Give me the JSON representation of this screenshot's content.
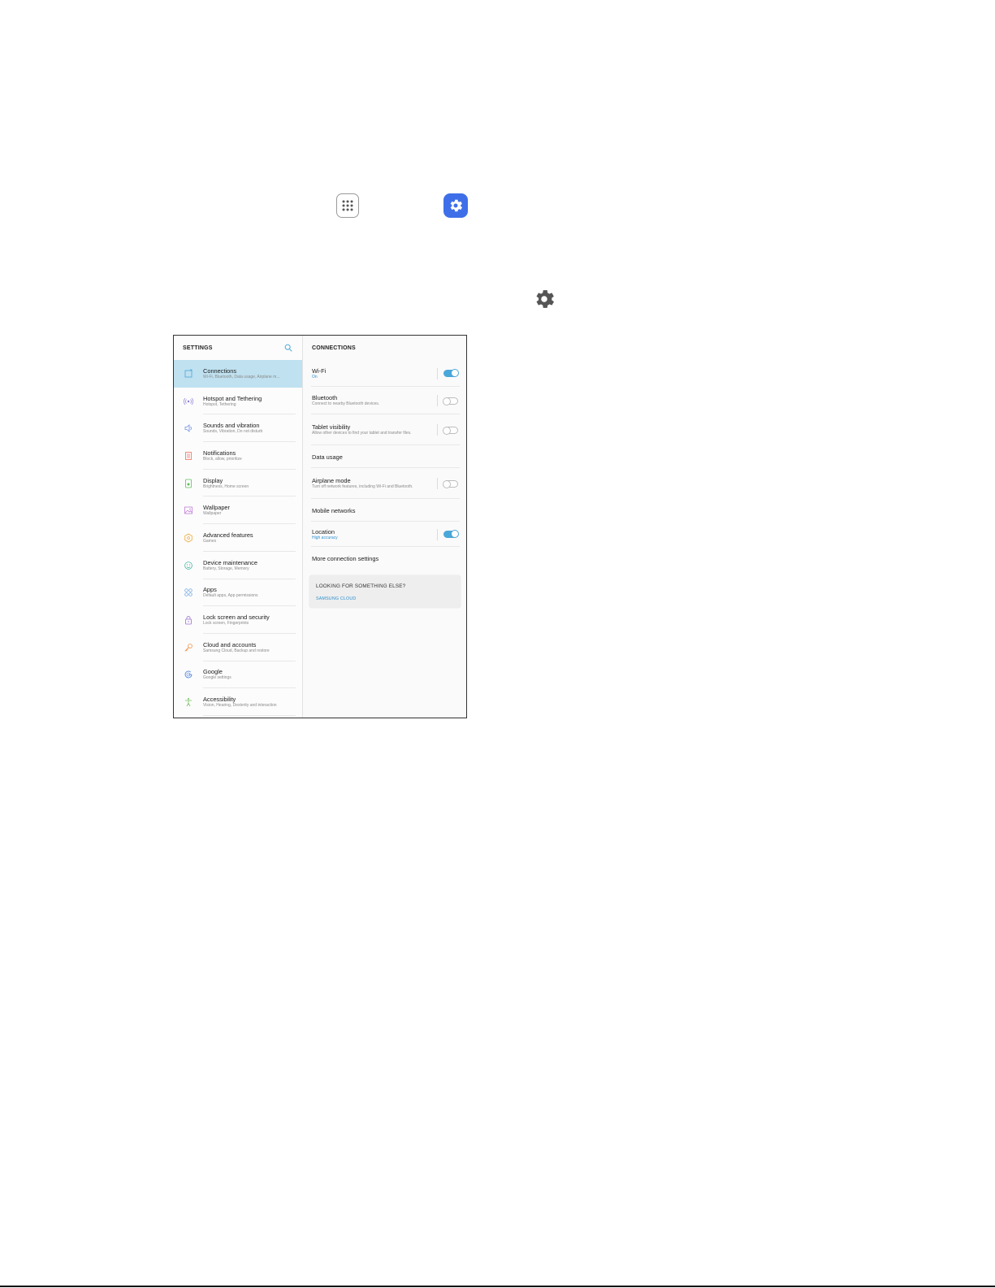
{
  "left_pane": {
    "header": "SETTINGS",
    "items": [
      {
        "title": "Connections",
        "subtitle": "Wi-Fi, Bluetooth, Data usage, Airplane m...",
        "icon": "connections-icon",
        "color": "#4aa7d9"
      },
      {
        "title": "Hotspot and Tethering",
        "subtitle": "Hotspot, Tethering",
        "icon": "hotspot-icon",
        "color": "#8a7ad6"
      },
      {
        "title": "Sounds and vibration",
        "subtitle": "Sounds, Vibration, Do not disturb",
        "icon": "speaker-icon",
        "color": "#6f8fe0"
      },
      {
        "title": "Notifications",
        "subtitle": "Block, allow, prioritize",
        "icon": "notifications-icon",
        "color": "#ef6f5c"
      },
      {
        "title": "Display",
        "subtitle": "Brightness, Home screen",
        "icon": "display-icon",
        "color": "#5fbf5a"
      },
      {
        "title": "Wallpaper",
        "subtitle": "Wallpaper",
        "icon": "wallpaper-icon",
        "color": "#c07ad6"
      },
      {
        "title": "Advanced features",
        "subtitle": "Games",
        "icon": "advanced-features-icon",
        "color": "#f0a83c"
      },
      {
        "title": "Device maintenance",
        "subtitle": "Battery, Storage, Memory",
        "icon": "device-maintenance-icon",
        "color": "#43b5a0"
      },
      {
        "title": "Apps",
        "subtitle": "Default apps, App permissions",
        "icon": "apps-grid-icon",
        "color": "#5a9be0"
      },
      {
        "title": "Lock screen and security",
        "subtitle": "Lock screen, Fingerprints",
        "icon": "lock-icon",
        "color": "#9b6fd6"
      },
      {
        "title": "Cloud and accounts",
        "subtitle": "Samsung Cloud, Backup and restore",
        "icon": "key-icon",
        "color": "#f08a3c"
      },
      {
        "title": "Google",
        "subtitle": "Google settings",
        "icon": "google-icon",
        "color": "#4a7fe0"
      },
      {
        "title": "Accessibility",
        "subtitle": "Vision, Hearing, Dexterity and interaction",
        "icon": "accessibility-icon",
        "color": "#6fbf5a"
      }
    ]
  },
  "right_pane": {
    "header": "CONNECTIONS",
    "rows": [
      {
        "title": "Wi-Fi",
        "subtitle": "On",
        "subtitle_accent": true,
        "toggle": "on"
      },
      {
        "title": "Bluetooth",
        "subtitle": "Connect to nearby Bluetooth devices.",
        "subtitle_accent": false,
        "toggle": "off"
      },
      {
        "title": "Tablet visibility",
        "subtitle": "Allow other devices to find your tablet and transfer files.",
        "subtitle_accent": false,
        "toggle": "off"
      },
      {
        "title": "Data usage",
        "subtitle": "",
        "subtitle_accent": false,
        "toggle": null
      },
      {
        "title": "Airplane mode",
        "subtitle": "Turn off network features, including Wi-Fi and Bluetooth.",
        "subtitle_accent": false,
        "toggle": "off"
      },
      {
        "title": "Mobile networks",
        "subtitle": "",
        "subtitle_accent": false,
        "toggle": null
      },
      {
        "title": "Location",
        "subtitle": "High accuracy",
        "subtitle_accent": true,
        "toggle": "on"
      },
      {
        "title": "More connection settings",
        "subtitle": "",
        "subtitle_accent": false,
        "toggle": null
      }
    ],
    "looking": {
      "title": "LOOKING FOR SOMETHING ELSE?",
      "link": "SAMSUNG CLOUD"
    }
  },
  "colors": {
    "accent": "#4aa7d9",
    "selected_bg": "#bfe1f0",
    "settings_app": "#3f6fe8"
  }
}
